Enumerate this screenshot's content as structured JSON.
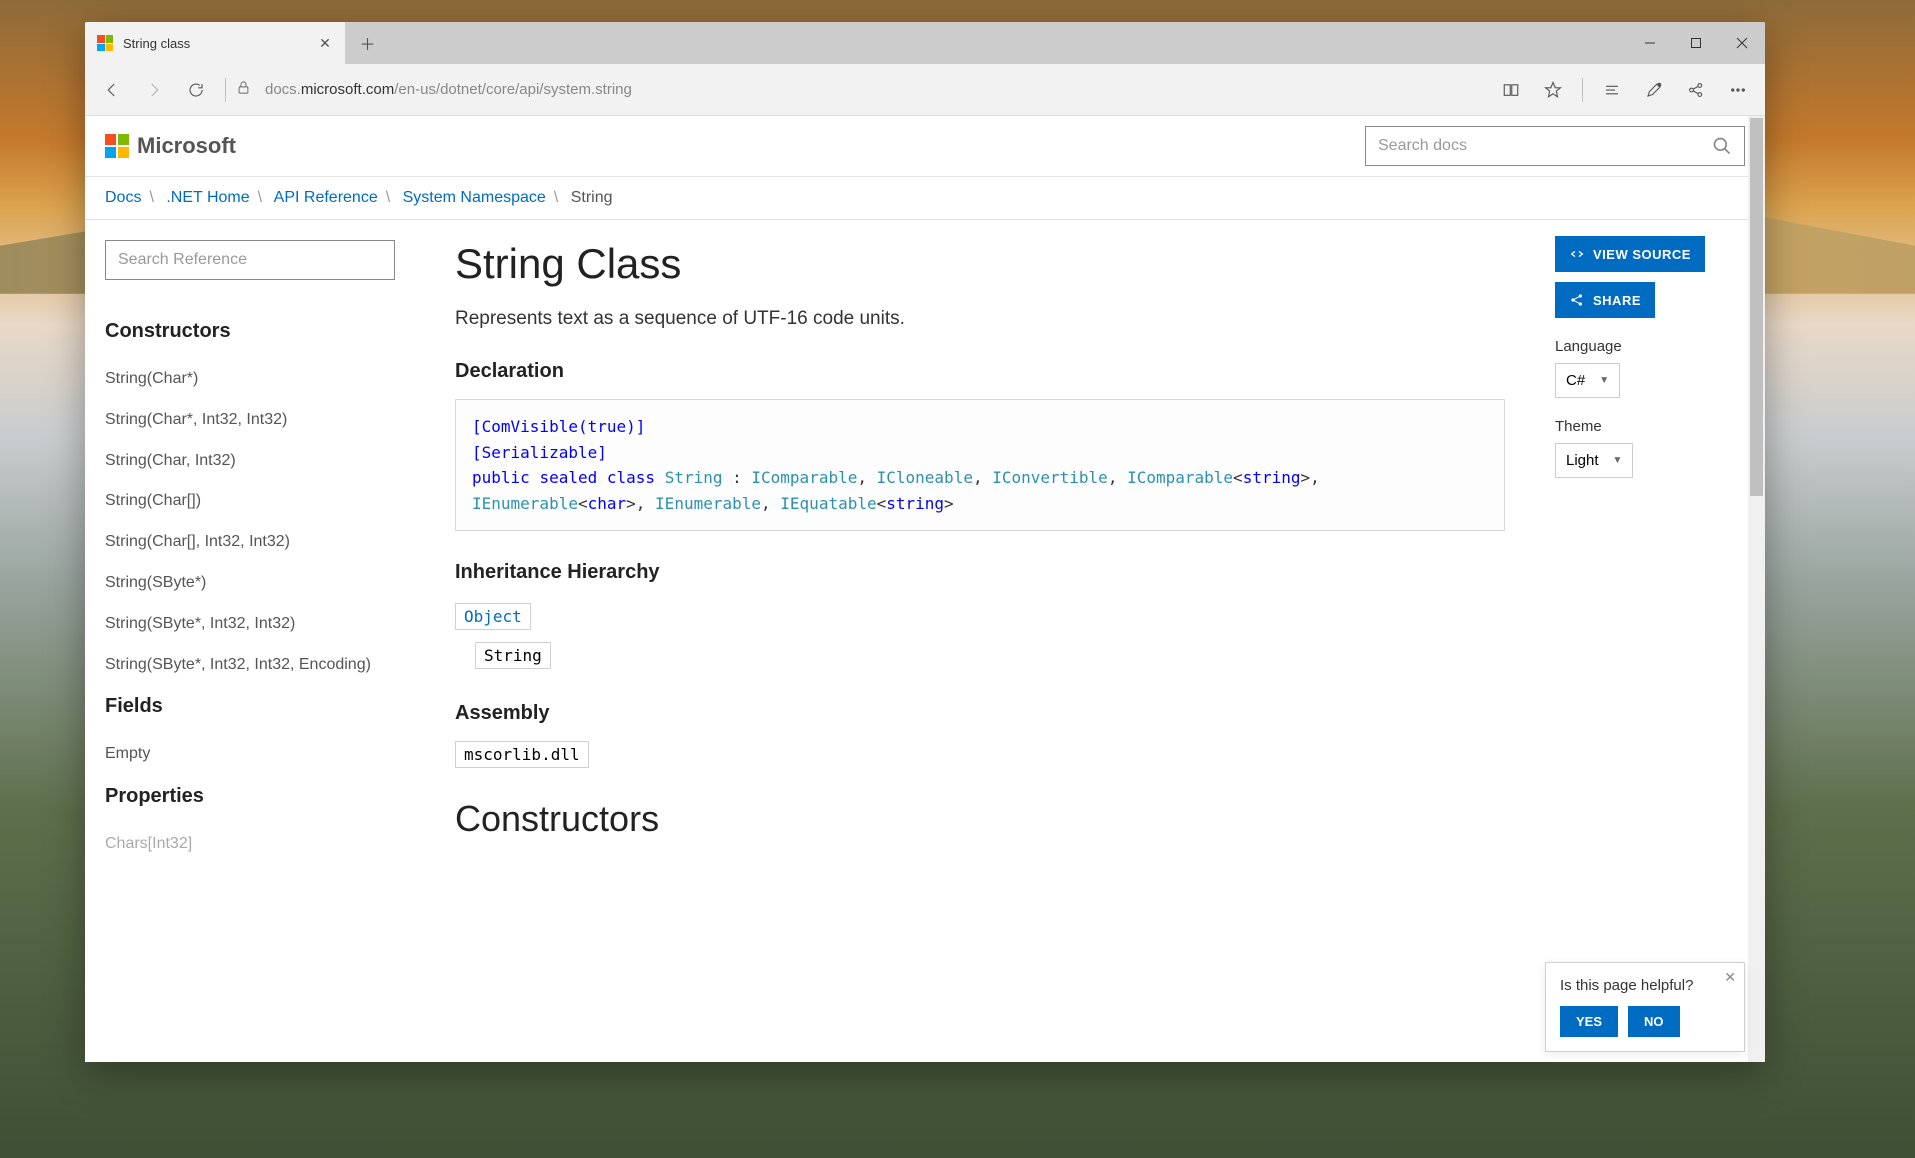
{
  "browser": {
    "tab_title": "String class",
    "url_prefix": "docs.",
    "url_bold": "microsoft.com",
    "url_suffix": "/en-us/dotnet/core/api/system.string"
  },
  "site": {
    "brand": "Microsoft",
    "search_placeholder": "Search docs"
  },
  "breadcrumb": {
    "items": [
      "Docs",
      ".NET Home",
      "API Reference",
      "System Namespace"
    ],
    "current": "String"
  },
  "sidebar": {
    "search_placeholder": "Search Reference",
    "groups": [
      {
        "title": "Constructors",
        "items": [
          "String(Char*)",
          "String(Char*, Int32, Int32)",
          "String(Char, Int32)",
          "String(Char[])",
          "String(Char[], Int32, Int32)",
          "String(SByte*)",
          "String(SByte*, Int32, Int32)",
          "String(SByte*, Int32, Int32, Encoding)"
        ]
      },
      {
        "title": "Fields",
        "items": [
          "Empty"
        ]
      },
      {
        "title": "Properties",
        "items": [
          "Chars[Int32]"
        ]
      }
    ]
  },
  "article": {
    "title": "String Class",
    "description": "Represents text as a sequence of UTF-16 code units.",
    "declaration_h": "Declaration",
    "inheritance_h": "Inheritance Hierarchy",
    "inherit_parent": "Object",
    "inherit_self": "String",
    "assembly_h": "Assembly",
    "assembly_name": "mscorlib.dll",
    "constructors_h": "Constructors",
    "code": {
      "l1": "[ComVisible(true)]",
      "l2": "[Serializable]",
      "kw_public": "public",
      "kw_sealed": "sealed",
      "kw_class": "class",
      "t_String": "String",
      "sep1": " : ",
      "t_IComparable": "IComparable",
      "t_ICloneable": "ICloneable",
      "t_IConvertible": "IConvertible",
      "t_IComparableT_a": "IComparable",
      "t_string": "string",
      "t_IEnumerableChar_a": "IEnumerable",
      "t_char": "char",
      "t_IEnumerable": "IEnumerable",
      "t_IEquatable_a": "IEquatable"
    }
  },
  "rail": {
    "view_source": "VIEW SOURCE",
    "share": "SHARE",
    "language_label": "Language",
    "language_value": "C#",
    "theme_label": "Theme",
    "theme_value": "Light"
  },
  "feedback": {
    "prompt": "Is this page helpful?",
    "yes": "YES",
    "no": "NO"
  }
}
